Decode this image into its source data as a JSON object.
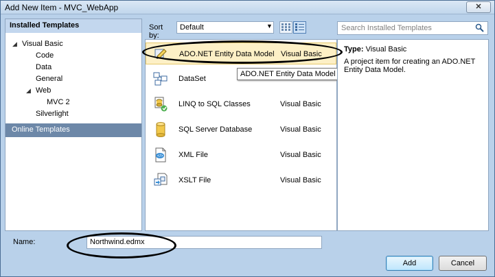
{
  "window": {
    "title": "Add New Item - MVC_WebApp",
    "close_icon": "close-icon"
  },
  "left_panel": {
    "header": "Installed Templates",
    "tree": [
      {
        "label": "Visual Basic",
        "expanded": true,
        "level": 0
      },
      {
        "label": "Code",
        "level": 1
      },
      {
        "label": "Data",
        "level": 1,
        "selected": true
      },
      {
        "label": "General",
        "level": 1
      },
      {
        "label": "Web",
        "expanded": true,
        "level": 1
      },
      {
        "label": "MVC 2",
        "level": 2
      },
      {
        "label": "Silverlight",
        "level": 1
      }
    ],
    "online_templates": "Online Templates"
  },
  "sort": {
    "label": "Sort by:",
    "value": "Default"
  },
  "search": {
    "placeholder": "Search Installed Templates"
  },
  "items": [
    {
      "name": "ADO.NET Entity Data Model",
      "language": "Visual Basic",
      "icon": "entity-model-icon",
      "selected": true
    },
    {
      "name": "DataSet",
      "language": "",
      "icon": "dataset-icon"
    },
    {
      "name": "LINQ to SQL Classes",
      "language": "Visual Basic",
      "icon": "linq-icon"
    },
    {
      "name": "SQL Server Database",
      "language": "Visual Basic",
      "icon": "database-icon"
    },
    {
      "name": "XML File",
      "language": "Visual Basic",
      "icon": "xml-file-icon"
    },
    {
      "name": "XSLT File",
      "language": "Visual Basic",
      "icon": "xslt-file-icon"
    }
  ],
  "tooltip": "ADO.NET Entity Data Model",
  "details": {
    "type_label": "Type:",
    "type_value": "Visual Basic",
    "description": "A project item for creating an ADO.NET Entity Data Model."
  },
  "name_field": {
    "label": "Name:",
    "value": "Northwind.edmx"
  },
  "buttons": {
    "add": "Add",
    "cancel": "Cancel"
  },
  "colors": {
    "window_bg": "#b9d1ea",
    "selected_item": "#fdf0c6",
    "online_templates_bg": "#6d88a8",
    "header_bg": "#c3d7ee"
  }
}
